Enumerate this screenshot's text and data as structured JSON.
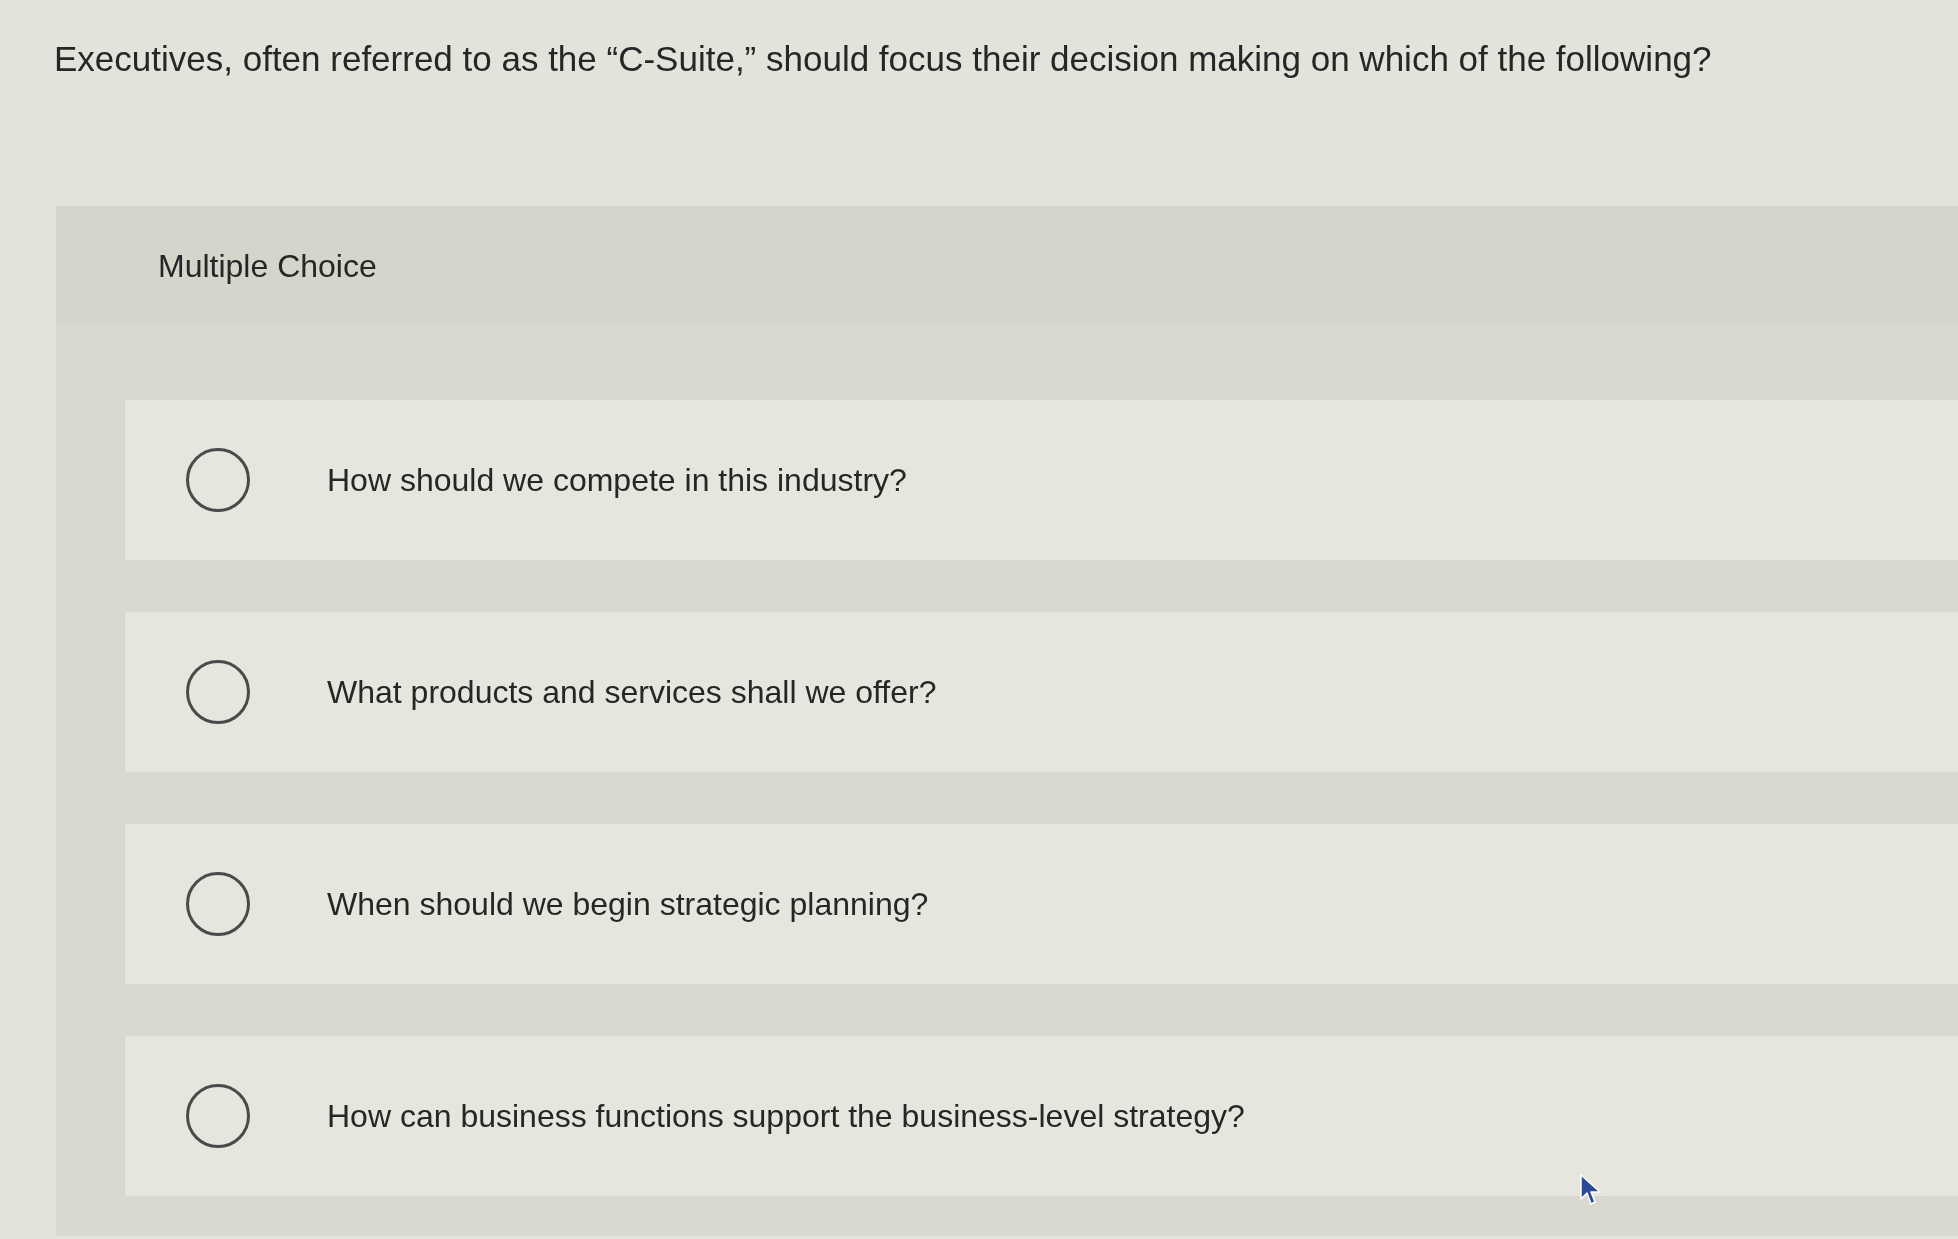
{
  "question": {
    "text": "Executives, often referred to as the “C-Suite,” should focus their decision making on which of the following?"
  },
  "panel": {
    "title": "Multiple Choice"
  },
  "options": [
    {
      "label": "How should we compete in this industry?",
      "selected": false
    },
    {
      "label": "What products and services shall we offer?",
      "selected": false
    },
    {
      "label": "When should we begin strategic planning?",
      "selected": false
    },
    {
      "label": "How can business functions support the business-level strategy?",
      "selected": false
    }
  ]
}
